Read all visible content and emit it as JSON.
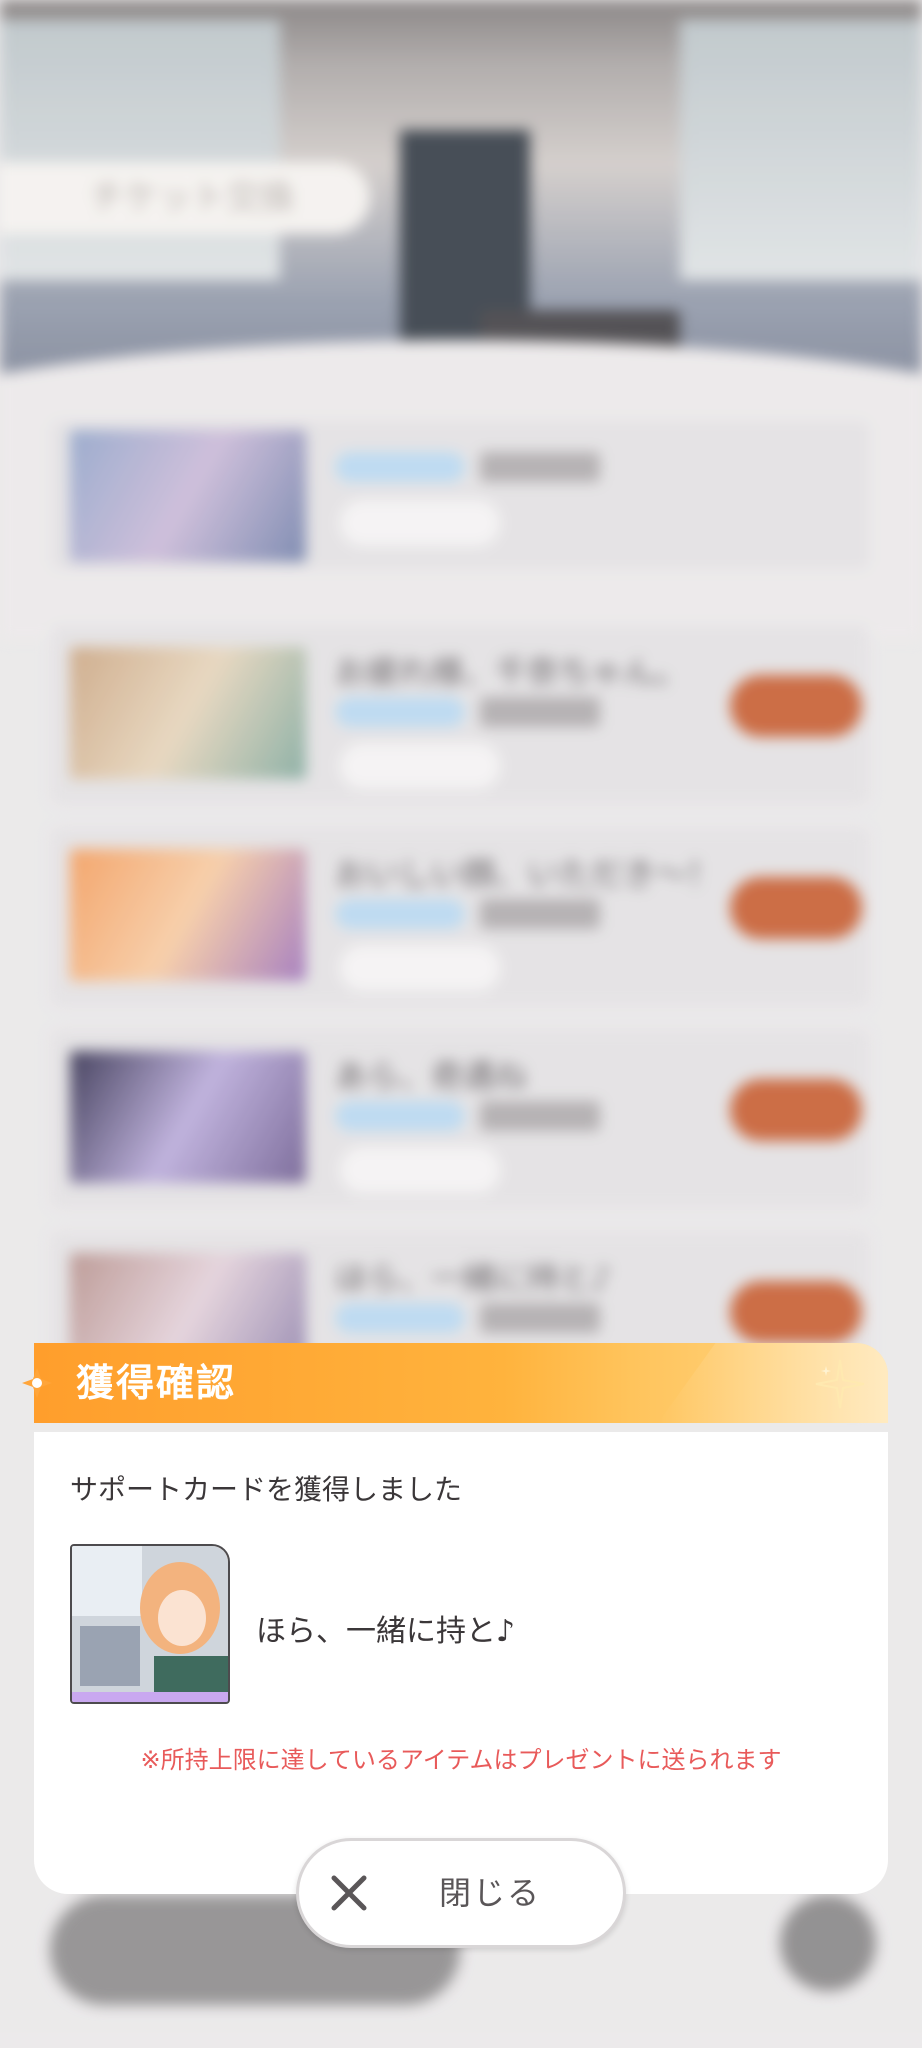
{
  "background": {
    "ticket_tab_label": "チケット交換",
    "list_rows": [
      {
        "title": ""
      },
      {
        "title": "お疲れ様、千奈ちゃん。"
      },
      {
        "title": "おいしい顔、いただき～！"
      },
      {
        "title": "あら、奇遇ね"
      },
      {
        "title": "ほら、一緒に持と♪"
      }
    ]
  },
  "dialog": {
    "title": "獲得確認",
    "message": "サポートカードを獲得しました",
    "card_name": "ほら、一緒に持と♪",
    "warning": "※所持上限に達しているアイテムはプレゼントに送られます",
    "close_label": "閉じる"
  },
  "colors": {
    "header_orange": "#ff9e2c",
    "warning_red": "#e85a5a",
    "exchange_button": "#c55a2d"
  },
  "icons": {
    "header": "diamond-icon",
    "decor": "sparkle-icon",
    "close": "close-icon"
  }
}
